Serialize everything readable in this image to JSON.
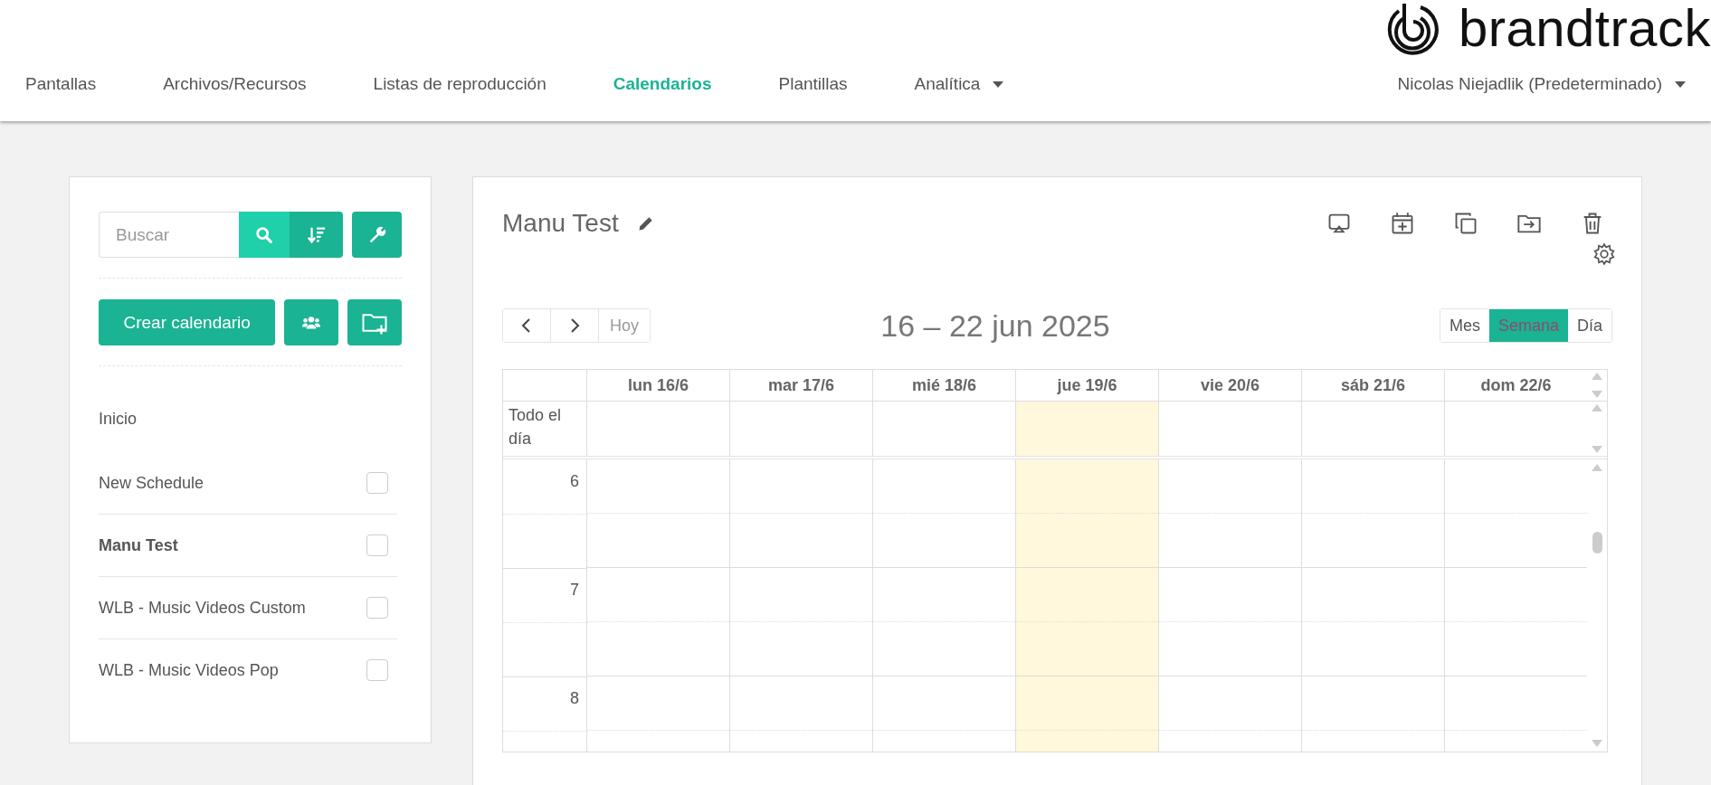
{
  "logo": {
    "text": "brandtrack"
  },
  "nav": [
    {
      "label": "Pantallas",
      "selected": false,
      "dropdown": false
    },
    {
      "label": "Archivos/Recursos",
      "selected": false,
      "dropdown": false
    },
    {
      "label": "Listas de reproducción",
      "selected": false,
      "dropdown": false
    },
    {
      "label": "Calendarios",
      "selected": true,
      "dropdown": false
    },
    {
      "label": "Plantillas",
      "selected": false,
      "dropdown": false
    },
    {
      "label": "Analítica",
      "selected": false,
      "dropdown": true
    }
  ],
  "user_menu": {
    "label": "Nicolas Niejadlik (Predeterminado)"
  },
  "sidebar": {
    "search": {
      "placeholder": "Buscar"
    },
    "create_button": "Crear calendario",
    "items": [
      {
        "kind": "folder",
        "label": "Inicio",
        "selected": false
      },
      {
        "kind": "calendar",
        "label": "New Schedule",
        "selected": false,
        "checked": false
      },
      {
        "kind": "calendar",
        "label": "Manu Test",
        "selected": true,
        "checked": false
      },
      {
        "kind": "calendar",
        "label": "WLB - Music Videos Custom",
        "selected": false,
        "checked": false
      },
      {
        "kind": "calendar",
        "label": "WLB - Music Videos Pop",
        "selected": false,
        "checked": false
      }
    ]
  },
  "calendar": {
    "title": "Manu Test",
    "today_button": "Hoy",
    "range": "16 – 22 jun 2025",
    "views": [
      {
        "label": "Mes",
        "selected": false
      },
      {
        "label": "Semana",
        "selected": true
      },
      {
        "label": "Día",
        "selected": false
      }
    ],
    "days": [
      {
        "label": "lun 16/6",
        "today": false
      },
      {
        "label": "mar 17/6",
        "today": false
      },
      {
        "label": "mié 18/6",
        "today": false
      },
      {
        "label": "jue 19/6",
        "today": true
      },
      {
        "label": "vie 20/6",
        "today": false
      },
      {
        "label": "sáb 21/6",
        "today": false
      },
      {
        "label": "dom 22/6",
        "today": false
      }
    ],
    "all_day_label": "Todo el día",
    "hours": [
      "6",
      "7",
      "8"
    ]
  }
}
